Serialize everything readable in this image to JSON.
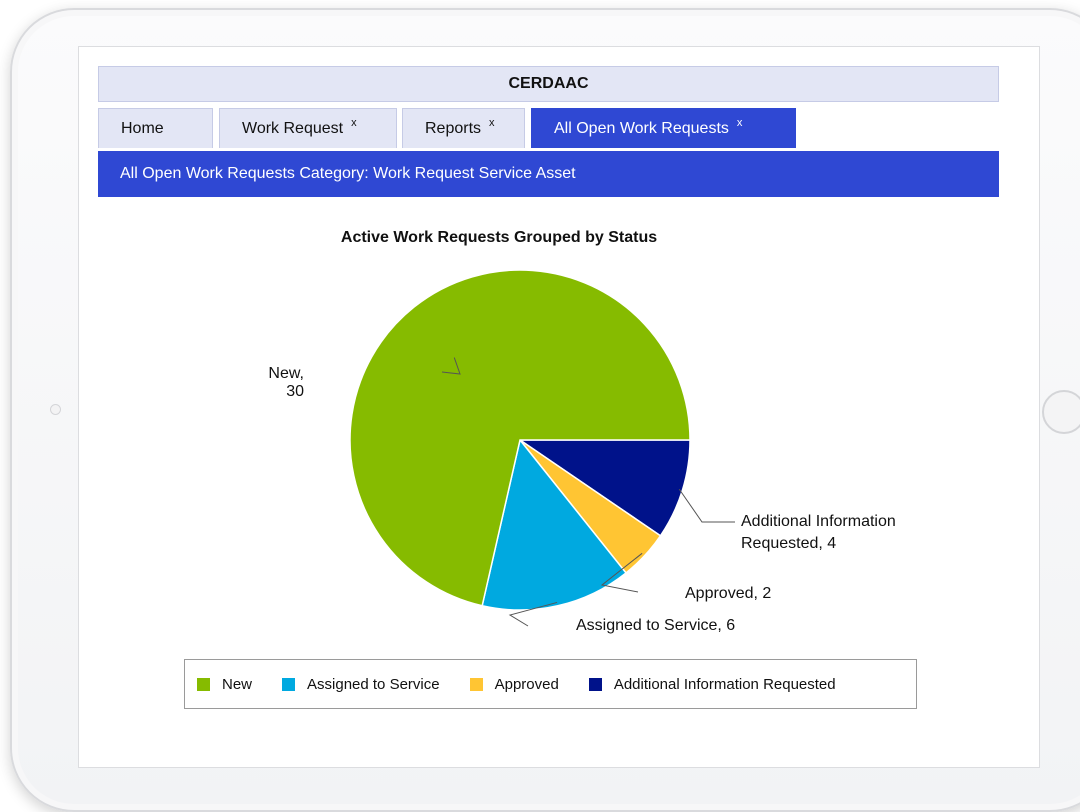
{
  "app": {
    "title": "CERDAAC"
  },
  "tabs": [
    {
      "label": "Home",
      "closable": false,
      "active": false
    },
    {
      "label": "Work Request",
      "close_label": "x",
      "closable": true,
      "active": false
    },
    {
      "label": "Reports",
      "close_label": "x",
      "closable": true,
      "active": false
    },
    {
      "label": "All Open Work Requests",
      "close_label": "x",
      "closable": true,
      "active": true
    }
  ],
  "subheader": "All Open Work Requests Category: Work Request Service Asset",
  "colors": {
    "accent": "#2f48d3",
    "tab_bg": "#e3e6f5",
    "new": "#86bb00",
    "assigned": "#00a9e0",
    "approved": "#ffc533",
    "additional": "#00128a"
  },
  "chart_data": {
    "type": "pie",
    "title": "Active Work Requests Grouped by Status",
    "categories": [
      "New",
      "Assigned to Service",
      "Approved",
      "Additional Information Requested"
    ],
    "values": [
      30,
      6,
      2,
      4
    ],
    "data_labels": [
      [
        "New,",
        "30"
      ],
      [
        "Assigned to Service, 6"
      ],
      [
        "Approved, 2"
      ],
      [
        "Additional Information",
        "Requested, 4"
      ]
    ],
    "legend_position": "bottom"
  }
}
